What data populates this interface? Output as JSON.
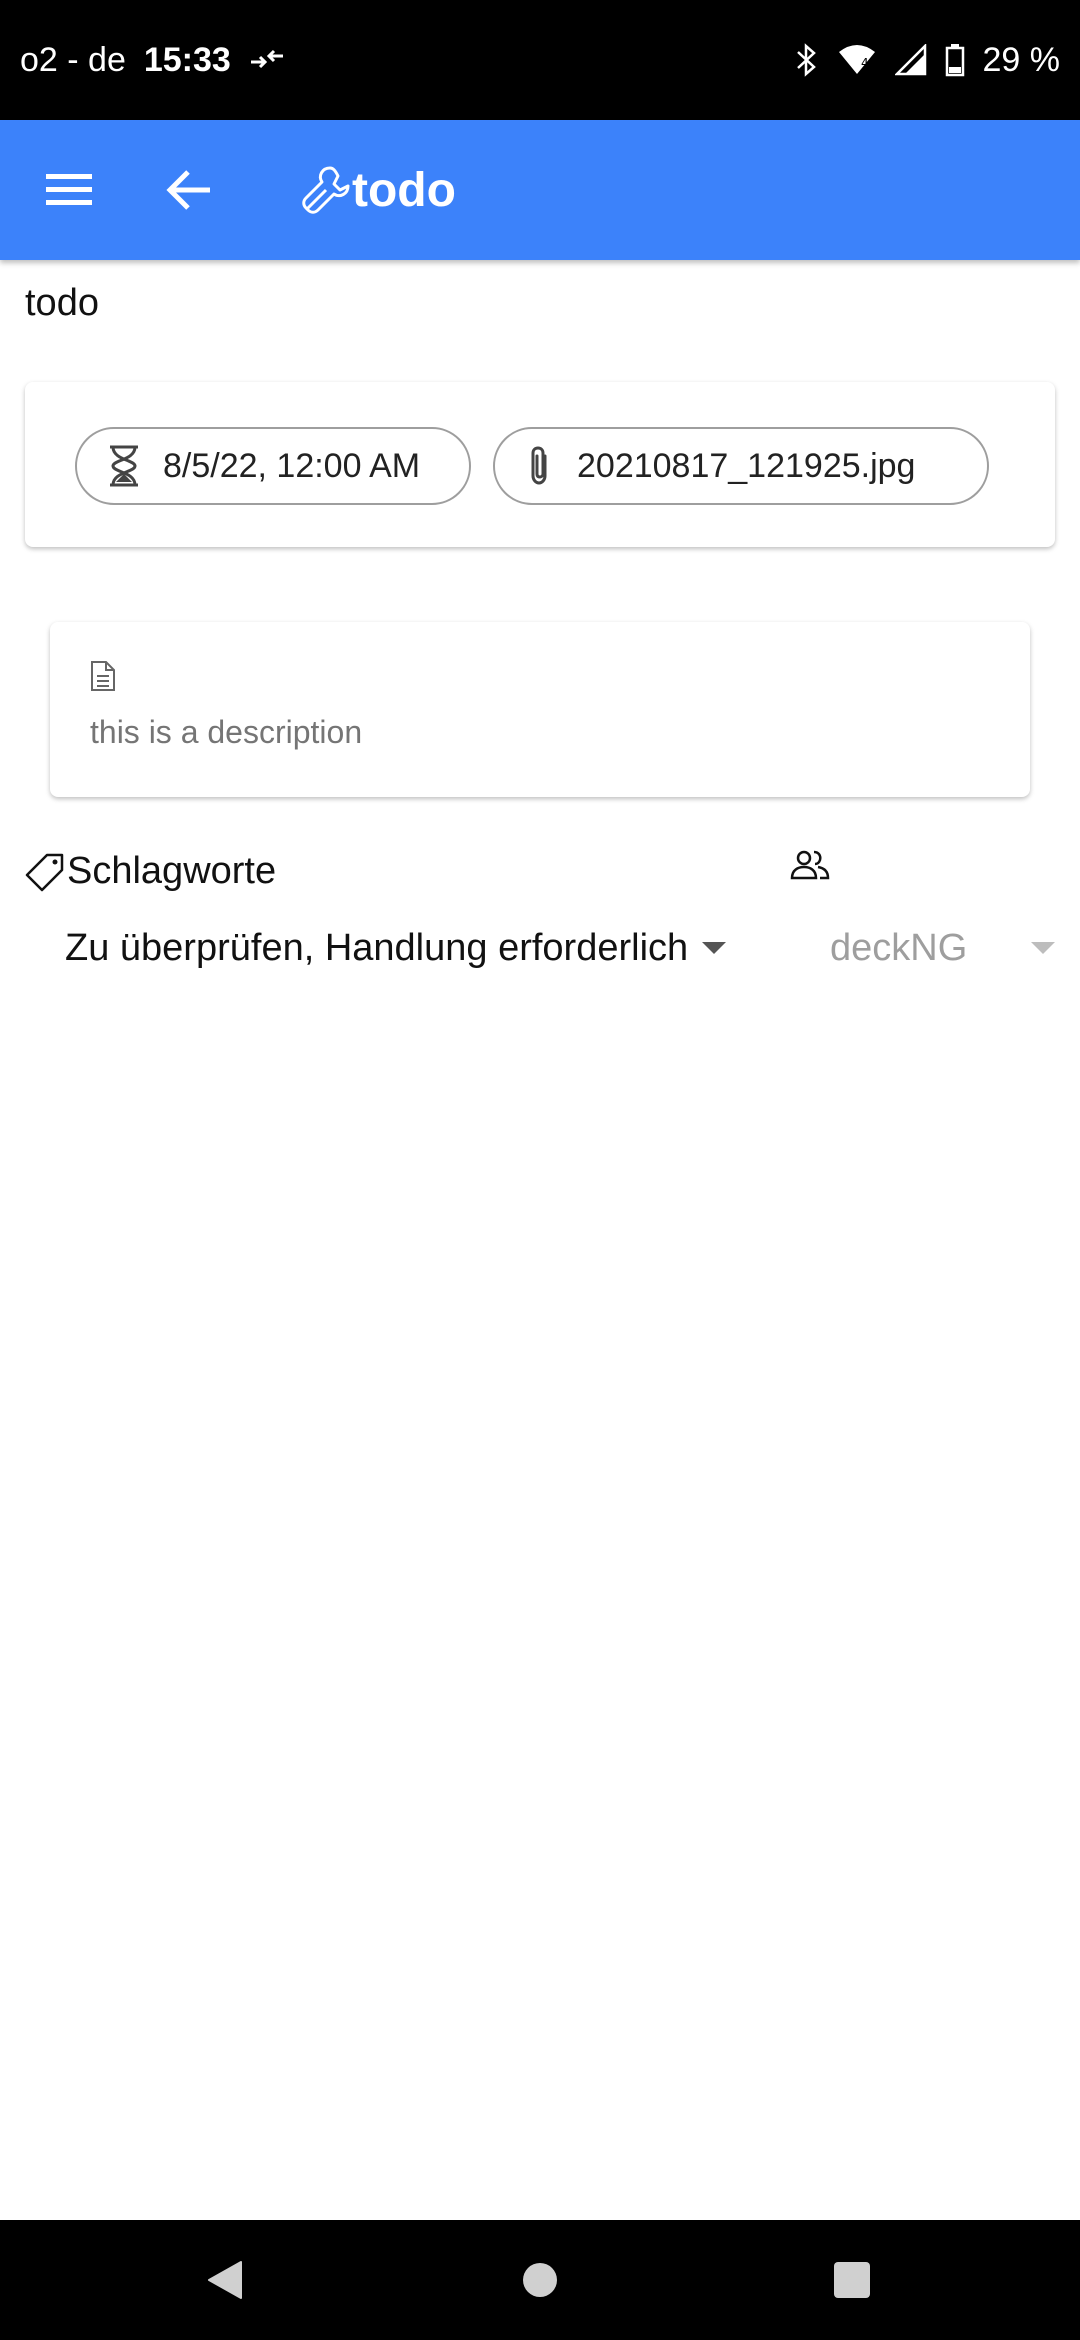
{
  "status_bar": {
    "carrier": "o2 - de",
    "time": "15:33",
    "battery": "29 %",
    "icons": [
      "data-transfer-icon",
      "bluetooth-icon",
      "wifi-icon",
      "signal-icon",
      "battery-icon"
    ]
  },
  "app_bar": {
    "title": "todo",
    "icons": [
      "menu-icon",
      "back-arrow-icon",
      "wrench-icon"
    ],
    "color": "#3c82fa"
  },
  "card": {
    "title": "todo",
    "due_date": "8/5/22, 12:00 AM",
    "attachment": "20210817_121925.jpg",
    "description": "this is a description"
  },
  "tags": {
    "label": "Schlagworte",
    "value": "Zu überprüfen, Handlung erforderlich"
  },
  "assignee": {
    "value": "deckNG"
  },
  "nav_bar": {
    "icons": [
      "nav-back-icon",
      "nav-home-icon",
      "nav-recents-icon"
    ]
  }
}
